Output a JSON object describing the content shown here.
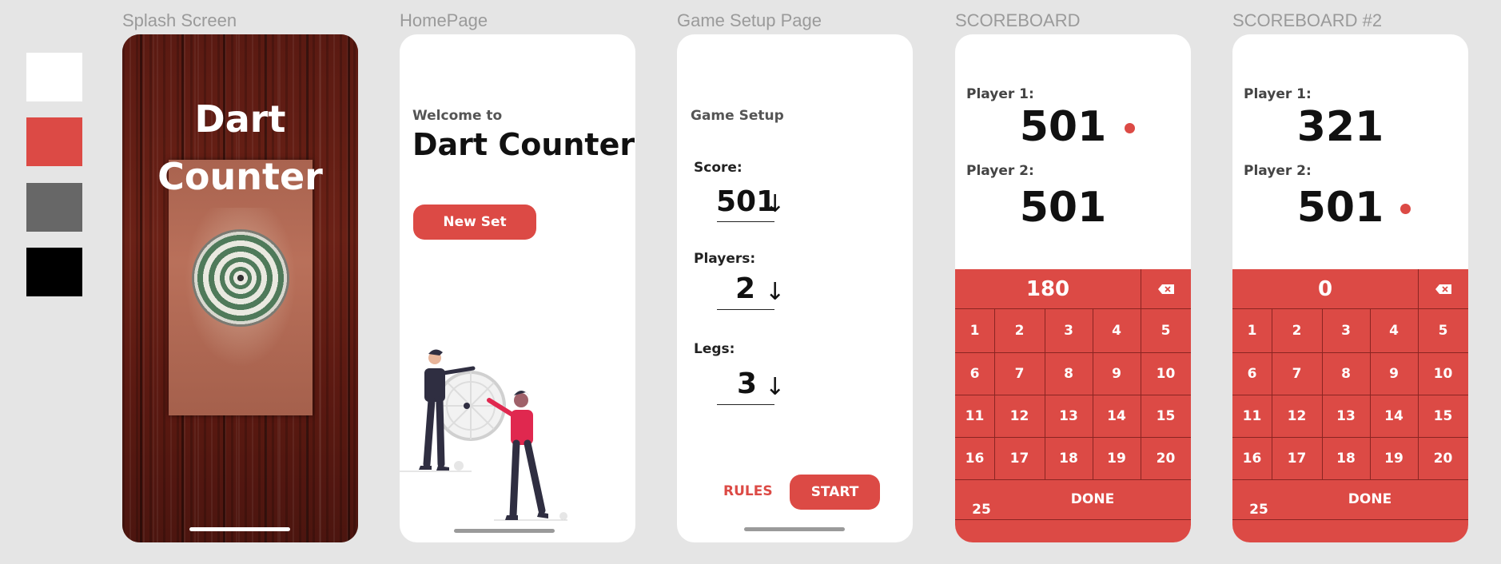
{
  "palette": {
    "swatches": [
      "#ffffff",
      "#dc4a45",
      "#676767",
      "#000000"
    ]
  },
  "frames": {
    "splash": {
      "title": "Splash Screen",
      "app_name_line1": "Dart",
      "app_name_line2": "Counter"
    },
    "home": {
      "title": "HomePage",
      "welcome": "Welcome to",
      "app_name": "Dart Counter",
      "new_set_label": "New Set"
    },
    "setup": {
      "title": "Game Setup Page",
      "heading": "Game Setup",
      "score_label": "Score:",
      "score_value": "501",
      "players_label": "Players:",
      "players_value": "2",
      "legs_label": "Legs:",
      "legs_value": "3",
      "arrow": "↓",
      "rules_label": "RULES",
      "start_label": "START"
    },
    "scoreboard1": {
      "title": "SCOREBOARD",
      "player1_label": "Player 1:",
      "player1_score": "501",
      "player2_label": "Player 2:",
      "player2_score": "501",
      "active_player": 1,
      "input_value": "180",
      "backspace_icon": "backspace-icon"
    },
    "scoreboard2": {
      "title": "SCOREBOARD #2",
      "player1_label": "Player 1:",
      "player1_score": "321",
      "player2_label": "Player 2:",
      "player2_score": "501",
      "active_player": 2,
      "input_value": "0",
      "backspace_icon": "backspace-icon"
    }
  },
  "keypad": {
    "rows": [
      [
        "1",
        "2",
        "3",
        "4",
        "5"
      ],
      [
        "6",
        "7",
        "8",
        "9",
        "10"
      ],
      [
        "11",
        "12",
        "13",
        "14",
        "15"
      ],
      [
        "16",
        "17",
        "18",
        "19",
        "20"
      ]
    ],
    "bottom_key": "25",
    "done_label": "DONE"
  },
  "colors": {
    "accent": "#dc4a45",
    "grey": "#676767"
  }
}
